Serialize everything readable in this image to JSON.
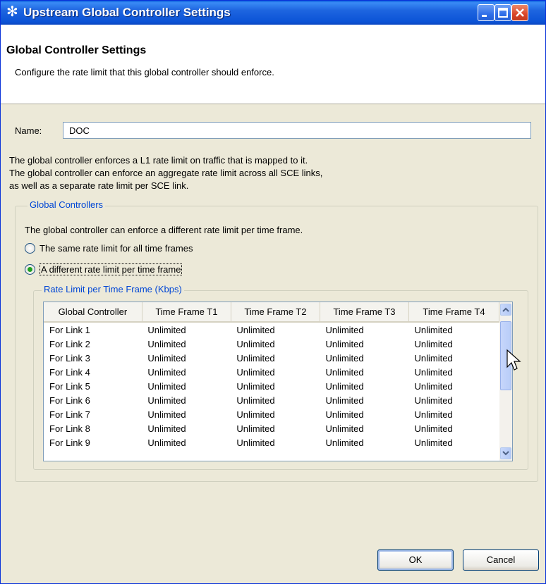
{
  "window": {
    "title": "Upstream Global Controller Settings",
    "app_icon": "asterisk-app-icon"
  },
  "header": {
    "title": "Global Controller Settings",
    "subtitle": "Configure the rate limit that this global controller should enforce."
  },
  "name_field": {
    "label": "Name:",
    "value": "DOC"
  },
  "description": [
    "The global controller enforces a L1 rate limit on traffic that is mapped to it.",
    "The global controller can enforce an aggregate rate limit across all SCE links,",
    "as well as a separate rate limit per SCE link."
  ],
  "global_controllers": {
    "legend": "Global Controllers",
    "intro": "The global controller can enforce a different rate limit per time frame.",
    "options": [
      {
        "label": "The same rate limit for all time frames",
        "selected": false
      },
      {
        "label": "A different rate limit per time frame",
        "selected": true
      }
    ]
  },
  "rate_limit_table": {
    "legend": "Rate Limit per Time Frame (Kbps)",
    "columns": [
      "Global Controller",
      "Time Frame T1",
      "Time Frame T2",
      "Time Frame T3",
      "Time Frame T4"
    ],
    "rows": [
      [
        "For Link 1",
        "Unlimited",
        "Unlimited",
        "Unlimited",
        "Unlimited"
      ],
      [
        "For Link 2",
        "Unlimited",
        "Unlimited",
        "Unlimited",
        "Unlimited"
      ],
      [
        "For Link 3",
        "Unlimited",
        "Unlimited",
        "Unlimited",
        "Unlimited"
      ],
      [
        "For Link 4",
        "Unlimited",
        "Unlimited",
        "Unlimited",
        "Unlimited"
      ],
      [
        "For Link 5",
        "Unlimited",
        "Unlimited",
        "Unlimited",
        "Unlimited"
      ],
      [
        "For Link 6",
        "Unlimited",
        "Unlimited",
        "Unlimited",
        "Unlimited"
      ],
      [
        "For Link 7",
        "Unlimited",
        "Unlimited",
        "Unlimited",
        "Unlimited"
      ],
      [
        "For Link 8",
        "Unlimited",
        "Unlimited",
        "Unlimited",
        "Unlimited"
      ],
      [
        "For Link 9",
        "Unlimited",
        "Unlimited",
        "Unlimited",
        "Unlimited"
      ]
    ]
  },
  "buttons": {
    "ok": "OK",
    "cancel": "Cancel"
  },
  "colors": {
    "titlebar": "#0b53d6",
    "legend_text": "#0046d5",
    "dialog_bg": "#ece9d8"
  }
}
